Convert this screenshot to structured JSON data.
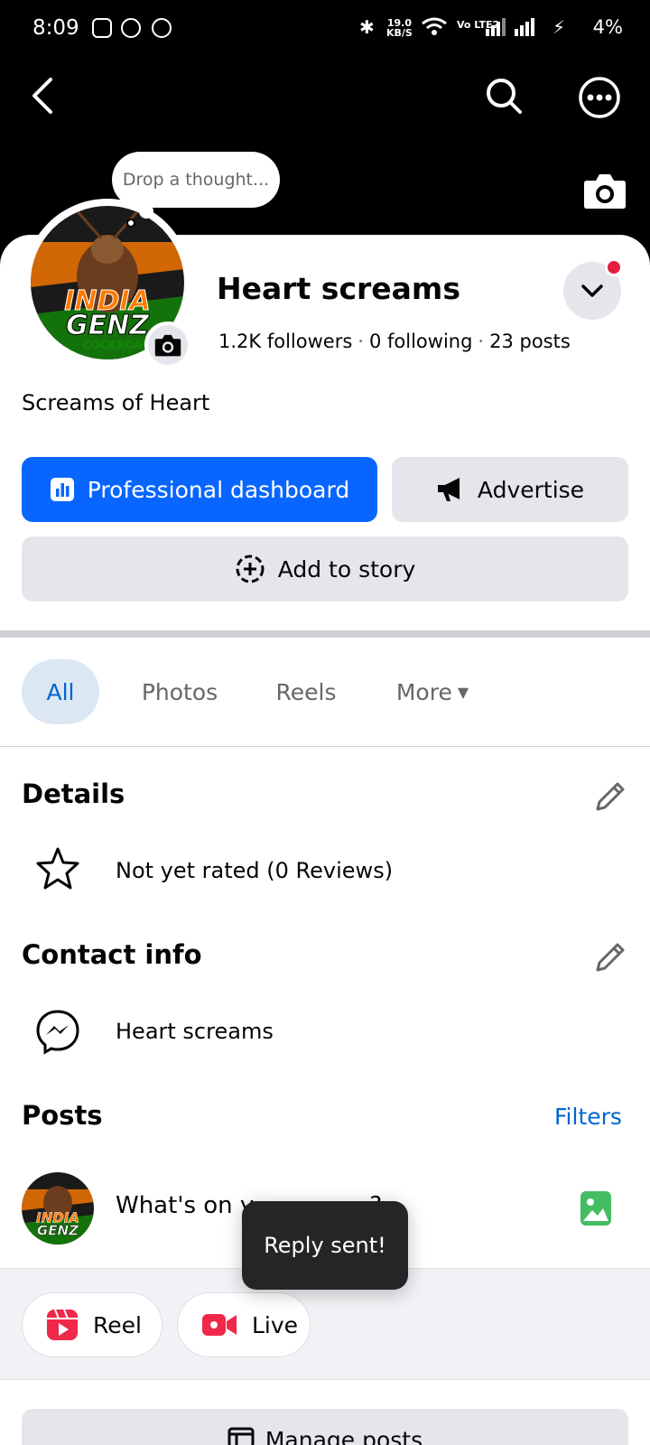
{
  "status_bar": {
    "time": "8:09",
    "net_speed": "19.0",
    "net_unit": "KB/S",
    "volte": "Vo LTE2",
    "battery": "4%",
    "icons": [
      "instagram-icon",
      "messenger-icon",
      "facebook-icon",
      "bluetooth-icon",
      "wifi-icon",
      "signal-icon",
      "charging-icon"
    ]
  },
  "header": {
    "back_icon": "arrow-left-icon",
    "search_icon": "search-icon",
    "more_icon": "more-horizontal-icon",
    "cover_camera_icon": "camera-icon"
  },
  "profile": {
    "thought_placeholder": "Drop a thought...",
    "avatar_label": "INDIA GENZ COCKROACH",
    "name": "Heart screams",
    "followers": "1.2K followers",
    "following": "0 following",
    "posts": "23 posts",
    "bio": "Screams of Heart"
  },
  "actions": {
    "professional_dashboard": "Professional dashboard",
    "advertise": "Advertise",
    "add_to_story": "Add to story"
  },
  "tabs": [
    {
      "label": "All",
      "active": true
    },
    {
      "label": "Photos",
      "active": false
    },
    {
      "label": "Reels",
      "active": false
    },
    {
      "label": "More",
      "active": false
    }
  ],
  "details": {
    "title": "Details",
    "rating": "Not yet rated (0 Reviews)"
  },
  "contact": {
    "title": "Contact info",
    "messenger": "Heart screams"
  },
  "posts": {
    "title": "Posts",
    "filters": "Filters",
    "composer_placeholder": "What's on y",
    "composer_suffix": "?"
  },
  "toast": "Reply sent!",
  "chips": {
    "reel": "Reel",
    "live": "Live"
  },
  "manage_posts": "Manage posts",
  "colors": {
    "brand_blue": "#0866ff",
    "link_blue": "#0064d1",
    "button_grey": "#e4e6eb",
    "notification_red": "#e41e3f",
    "reel_red": "#f0284a",
    "photo_green": "#45bd62"
  }
}
